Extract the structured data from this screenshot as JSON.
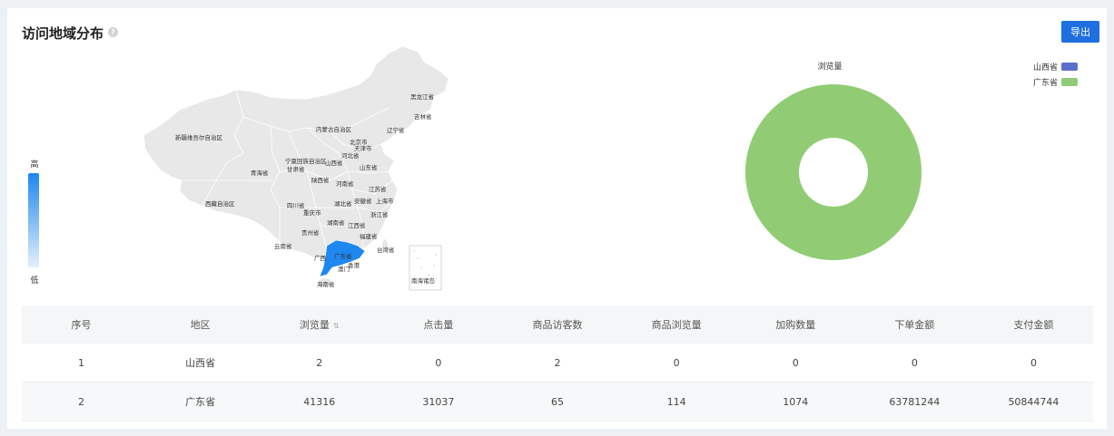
{
  "header": {
    "title": "访问地域分布",
    "help_icon": "?",
    "export_label": "导出"
  },
  "visual_map": {
    "high_label": "高",
    "low_label": "低",
    "color_high": "#1e88f0",
    "color_low": "#e4effa"
  },
  "map": {
    "highlighted_region": "广东省",
    "highlight_color": "#1e88f0",
    "province_color": "#e8e8e8",
    "labels": {
      "heilongjiang": "黑龙江省",
      "jilin": "吉林省",
      "liaoning": "辽宁省",
      "neimenggu": "内蒙古自治区",
      "xinjiang": "新疆维吾尔自治区",
      "beijing": "北京市",
      "tianjin": "天津市",
      "hebei": "河北省",
      "ningxia": "宁夏回族自治区",
      "shanxi": "山西省",
      "gansu": "甘肃省",
      "qinghai": "青海省",
      "shandong": "山东省",
      "shaanxi": "陕西省",
      "henan": "河南省",
      "jiangsu": "江苏省",
      "xizang": "西藏自治区",
      "sichuan": "四川省",
      "hubei": "湖北省",
      "anhui": "安徽省",
      "shanghai": "上海市",
      "chongqing": "重庆市",
      "zhejiang": "浙江省",
      "hunan": "湖南省",
      "jiangxi": "江西省",
      "guizhou": "贵州省",
      "fujian": "福建省",
      "yunnan": "云南省",
      "guangxi": "广西",
      "guangdong": "广东省",
      "taiwan": "台湾省",
      "hongkong": "香港",
      "macau": "澳门",
      "hainan": "海南省",
      "south_sea": "南海诸岛"
    }
  },
  "pie": {
    "title": "浏览量",
    "legend": [
      {
        "name": "山西省",
        "color": "#5b6fc8"
      },
      {
        "name": "广东省",
        "color": "#91cc75"
      }
    ]
  },
  "chart_data": {
    "type": "pie",
    "title": "浏览量",
    "categories": [
      "山西省",
      "广东省"
    ],
    "values": [
      2,
      41316
    ],
    "colors": [
      "#5b6fc8",
      "#91cc75"
    ],
    "legend_position": "top-right"
  },
  "table": {
    "columns": [
      "序号",
      "地区",
      "浏览量",
      "点击量",
      "商品访客数",
      "商品浏览量",
      "加购数量",
      "下单金额",
      "支付金额"
    ],
    "rows": [
      [
        "1",
        "山西省",
        "2",
        "0",
        "2",
        "0",
        "0",
        "0",
        "0"
      ],
      [
        "2",
        "广东省",
        "41316",
        "31037",
        "65",
        "114",
        "1074",
        "63781244",
        "50844744"
      ]
    ]
  }
}
